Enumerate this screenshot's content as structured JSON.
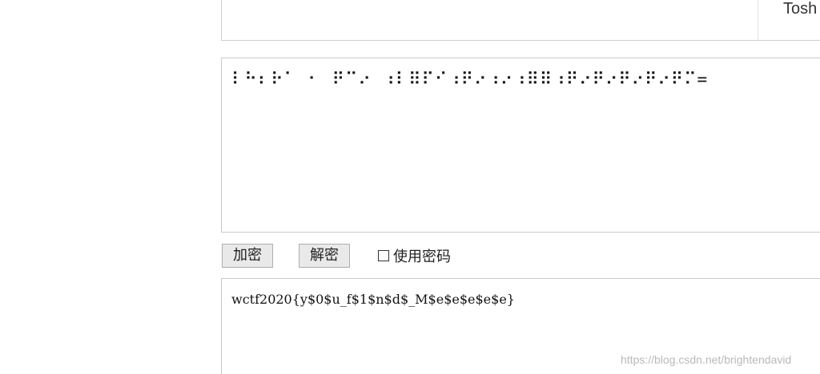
{
  "top_panel": {
    "right_text": "Tosh"
  },
  "input": {
    "value": "⠇⠓⠆⠗⠁ ⠂ ⠟⠉⠔ ⠰⠇⠿⠏⠊⠰⠟⠔⠰⠔⠰⠿⠿⠰⠟⠔⠟⠔⠟⠔⠟⠔⠟⠍="
  },
  "controls": {
    "encrypt_label": "加密",
    "decrypt_label": "解密",
    "use_password_label": "使用密码",
    "use_password_checked": false
  },
  "output": {
    "value": "wctf2020{y$0$u_f$1$n$d$_M$e$e$e$e$e}"
  },
  "watermark": "https://blog.csdn.net/brightendavid"
}
